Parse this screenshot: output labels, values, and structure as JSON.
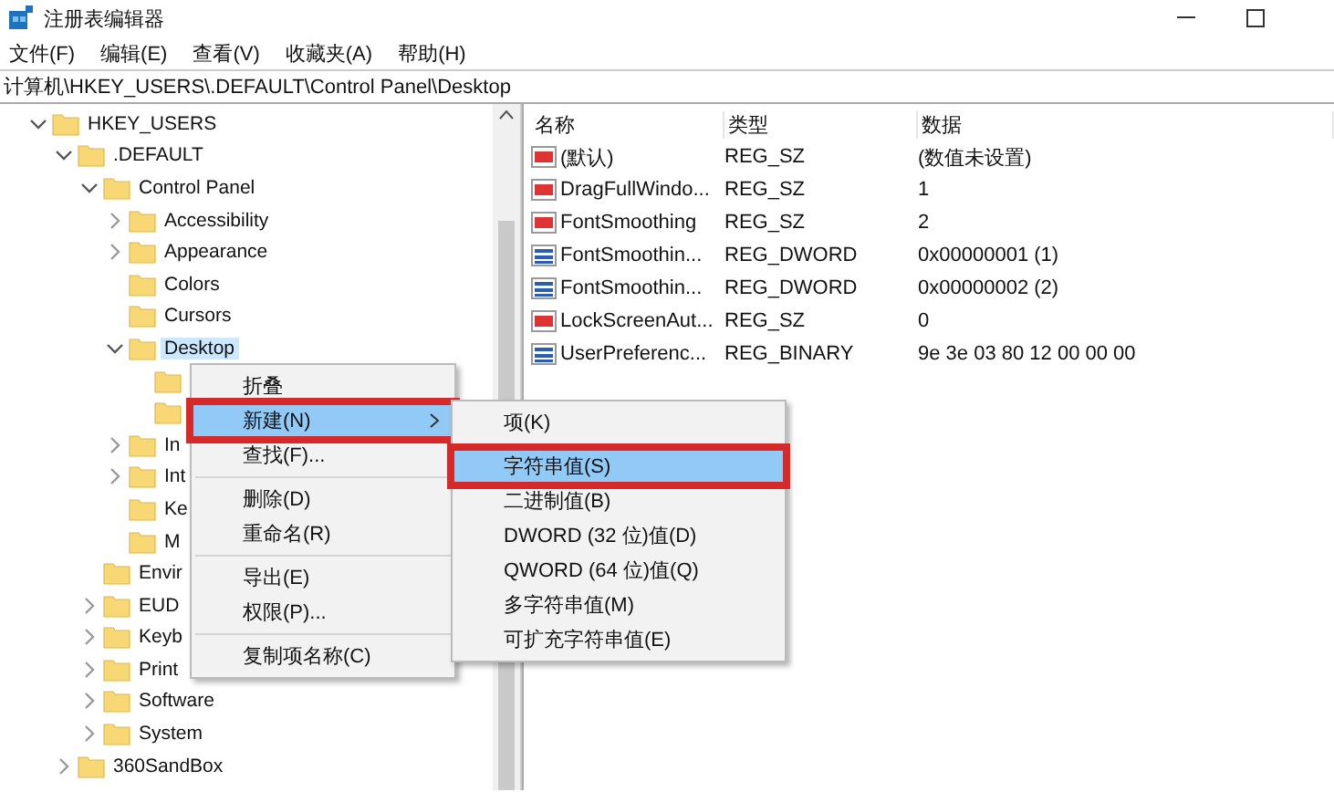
{
  "window": {
    "title": "注册表编辑器"
  },
  "menu_bar": [
    "文件(F)",
    "编辑(E)",
    "查看(V)",
    "收藏夹(A)",
    "帮助(H)"
  ],
  "address": "计算机\\HKEY_USERS\\.DEFAULT\\Control Panel\\Desktop",
  "tree": [
    {
      "label": "HKEY_USERS",
      "expanded": true,
      "selected": false,
      "children": [
        {
          "label": ".DEFAULT",
          "expanded": true,
          "selected": false,
          "children": [
            {
              "label": "Control Panel",
              "expanded": true,
              "selected": false,
              "children": [
                {
                  "label": "Accessibility",
                  "expanded": false,
                  "selected": false
                },
                {
                  "label": "Appearance",
                  "expanded": false,
                  "selected": false
                },
                {
                  "label": "Colors",
                  "selected": false
                },
                {
                  "label": "Cursors",
                  "selected": false
                },
                {
                  "label": "Desktop",
                  "expanded": true,
                  "selected": true,
                  "children": [
                    {
                      "selected": false
                    },
                    {
                      "selected": false
                    }
                  ]
                },
                {
                  "label": "In",
                  "expanded": false,
                  "selected": false
                },
                {
                  "label": "Int",
                  "expanded": false,
                  "selected": false
                },
                {
                  "label": "Ke",
                  "selected": false
                },
                {
                  "label": "M",
                  "selected": false
                }
              ]
            },
            {
              "label": "Envir",
              "selected": false
            },
            {
              "label": "EUD",
              "expanded": false,
              "selected": false
            },
            {
              "label": "Keyb",
              "expanded": false,
              "selected": false
            },
            {
              "label": "Print",
              "expanded": false,
              "selected": false
            },
            {
              "label": "Software",
              "expanded": false,
              "selected": false
            },
            {
              "label": "System",
              "expanded": false,
              "selected": false
            }
          ]
        },
        {
          "label": "360SandBox",
          "expanded": false,
          "selected": false
        }
      ]
    }
  ],
  "values_table": {
    "columns": [
      "名称",
      "类型",
      "数据"
    ],
    "rows": [
      {
        "kind": "string",
        "name": "(默认)",
        "type": "REG_SZ",
        "data": "(数值未设置)"
      },
      {
        "kind": "string",
        "name": "DragFullWindo...",
        "type": "REG_SZ",
        "data": "1"
      },
      {
        "kind": "string",
        "name": "FontSmoothing",
        "type": "REG_SZ",
        "data": "2"
      },
      {
        "kind": "binary",
        "name": "FontSmoothin...",
        "type": "REG_DWORD",
        "data": "0x00000001 (1)"
      },
      {
        "kind": "binary",
        "name": "FontSmoothin...",
        "type": "REG_DWORD",
        "data": "0x00000002 (2)"
      },
      {
        "kind": "string",
        "name": "LockScreenAut...",
        "type": "REG_SZ",
        "data": "0"
      },
      {
        "kind": "binary",
        "name": "UserPreferenc...",
        "type": "REG_BINARY",
        "data": "9e 3e 03 80 12 00 00 00"
      }
    ]
  },
  "context_menu": [
    {
      "kind": "item",
      "label": "折叠",
      "selected": false,
      "annotated": false
    },
    {
      "kind": "submenu",
      "label": "新建(N)",
      "selected": true,
      "annotated": true
    },
    {
      "kind": "item",
      "label": "查找(F)...",
      "selected": false,
      "annotated": false
    },
    {
      "kind": "separator"
    },
    {
      "kind": "item",
      "label": "删除(D)",
      "selected": false,
      "annotated": false
    },
    {
      "kind": "item",
      "label": "重命名(R)",
      "selected": false,
      "annotated": false
    },
    {
      "kind": "separator"
    },
    {
      "kind": "item",
      "label": "导出(E)",
      "selected": false,
      "annotated": false
    },
    {
      "kind": "item",
      "label": "权限(P)...",
      "selected": false,
      "annotated": false
    },
    {
      "kind": "separator"
    },
    {
      "kind": "item",
      "label": "复制项名称(C)",
      "selected": false,
      "annotated": false
    }
  ],
  "submenu": [
    {
      "kind": "item",
      "label": "项(K)",
      "selected": false,
      "annotated": false
    },
    {
      "kind": "separator"
    },
    {
      "kind": "item",
      "label": "字符串值(S)",
      "selected": true,
      "annotated": true
    },
    {
      "kind": "item",
      "label": "二进制值(B)",
      "selected": false,
      "annotated": false
    },
    {
      "kind": "item",
      "label": "DWORD (32 位)值(D)",
      "selected": false,
      "annotated": false
    },
    {
      "kind": "item",
      "label": "QWORD (64 位)值(Q)",
      "selected": false,
      "annotated": false
    },
    {
      "kind": "item",
      "label": "多字符串值(M)",
      "selected": false,
      "annotated": false
    },
    {
      "kind": "item",
      "label": "可扩充字符串值(E)",
      "selected": false,
      "annotated": false
    }
  ]
}
